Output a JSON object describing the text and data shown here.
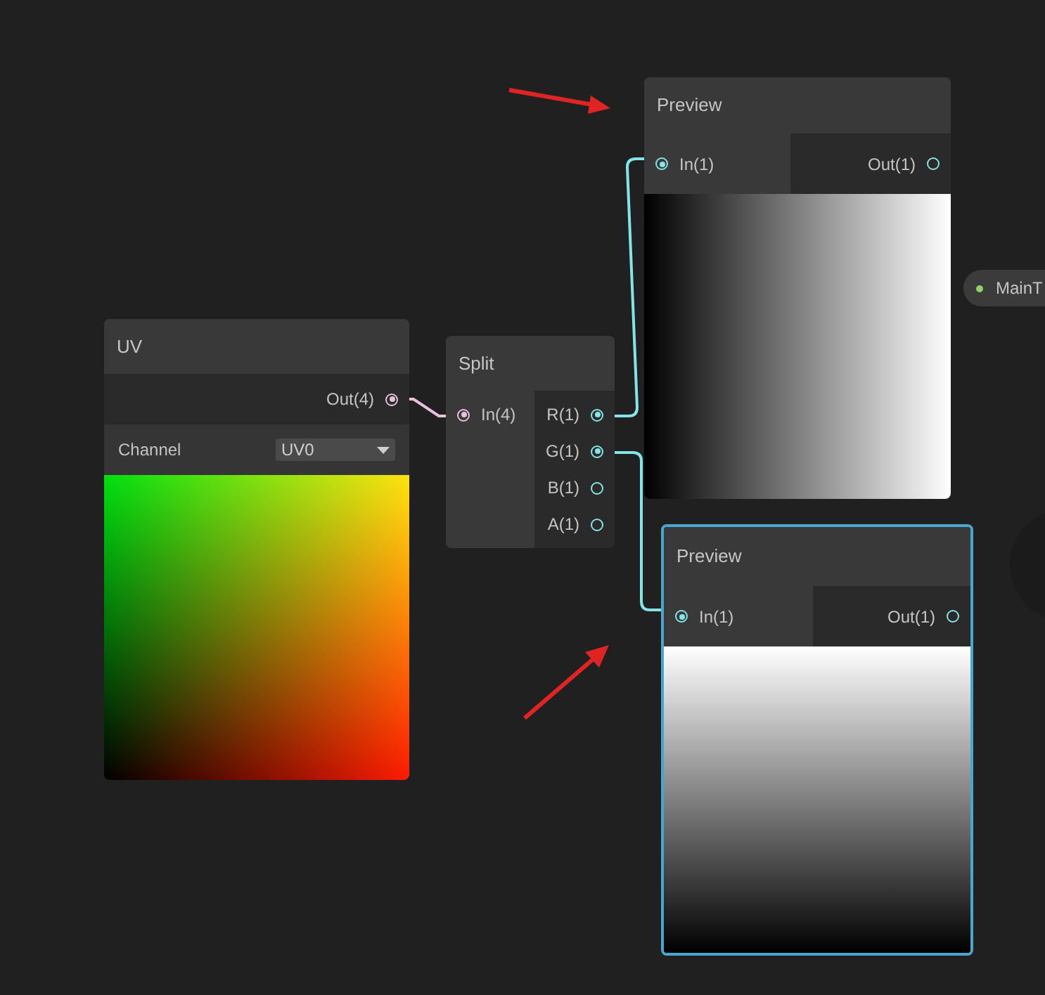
{
  "nodes": [
    {
      "kind": "uv",
      "title": "UV",
      "selected": false,
      "outputs": [
        {
          "label": "Out(4)",
          "connected": true,
          "color": "#e9bfdc"
        }
      ],
      "field": {
        "label": "Channel",
        "value": "UV0"
      }
    },
    {
      "kind": "split",
      "title": "Split",
      "selected": false,
      "inputs": [
        {
          "label": "In(4)",
          "connected": true,
          "color": "#e9bfdc"
        }
      ],
      "outputs": [
        {
          "label": "R(1)",
          "connected": true,
          "color": "#84e4e7"
        },
        {
          "label": "G(1)",
          "connected": true,
          "color": "#84e4e7"
        },
        {
          "label": "B(1)",
          "connected": false,
          "color": "#84e4e7"
        },
        {
          "label": "A(1)",
          "connected": false,
          "color": "#84e4e7"
        }
      ]
    },
    {
      "kind": "preview",
      "title": "Preview",
      "selected": false,
      "inputs": [
        {
          "label": "In(1)",
          "connected": true,
          "color": "#84e4e7"
        }
      ],
      "outputs": [
        {
          "label": "Out(1)",
          "connected": false,
          "color": "#84e4e7"
        }
      ]
    },
    {
      "kind": "preview",
      "title": "Preview",
      "selected": true,
      "inputs": [
        {
          "label": "In(1)",
          "connected": true,
          "color": "#84e4e7"
        }
      ],
      "outputs": [
        {
          "label": "Out(1)",
          "connected": false,
          "color": "#84e4e7"
        }
      ]
    }
  ],
  "property_pill": {
    "label": "MainT"
  }
}
